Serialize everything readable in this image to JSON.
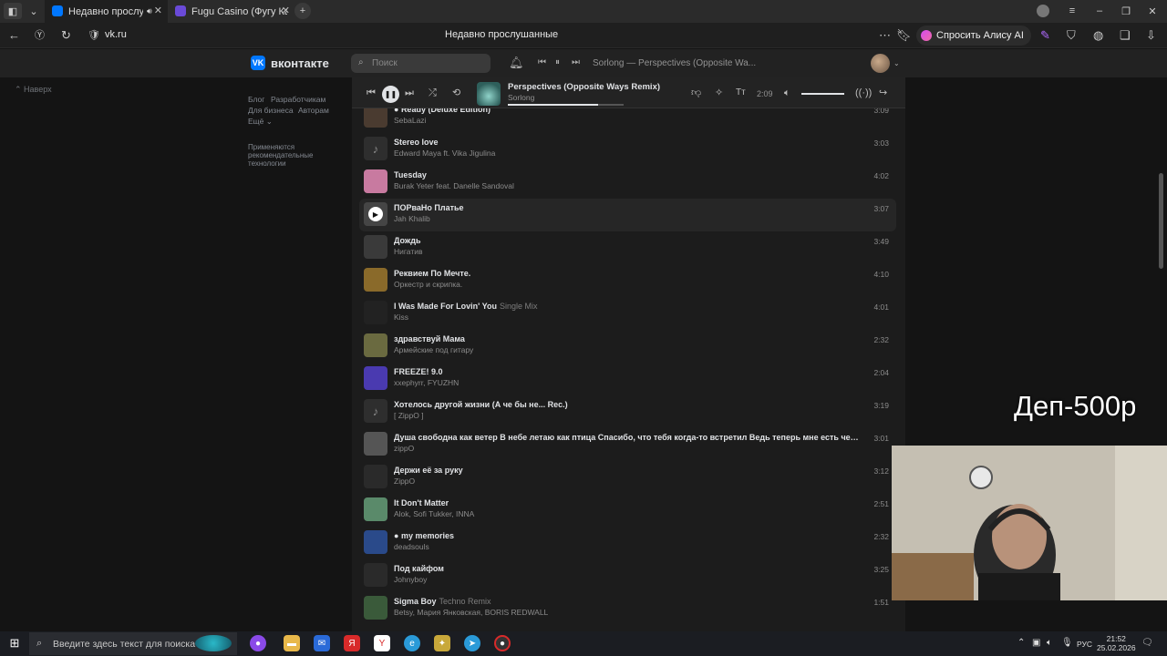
{
  "browser": {
    "tabs": [
      {
        "label": "Недавно прослушанные",
        "active": true
      },
      {
        "label": "Fugu Casino (Фугу Казино)",
        "active": false
      }
    ],
    "url": "vk.ru",
    "page_title": "Недавно прослушанные",
    "alice_label": "Спросить Алису AI"
  },
  "vk": {
    "logo_text": "вконтакте",
    "search_placeholder": "Поиск",
    "header_track": "Sorlong — Perspectives (Opposite Wa..."
  },
  "left": {
    "naverh": "Наверх",
    "links": [
      "Блог",
      "Разработчикам",
      "Для бизнеса",
      "Авторам",
      "Ещё ⌄"
    ],
    "reco": "Применяются рекомендательные технологии"
  },
  "player": {
    "title": "Perspectives (Opposite Ways Remix)",
    "artist": "Sorlong",
    "time": "2:09",
    "progress": 0.78,
    "volume": 1.0
  },
  "tracks": [
    {
      "title": "Ready (Deluxe Edition)",
      "prefix": "● ",
      "artist": "SebaLazi",
      "dur": "3:09",
      "cover": "#4a3b30"
    },
    {
      "title": "Stereo love",
      "artist": "Edward Maya ft. Vika Jigulina",
      "dur": "3:03",
      "cover": "note"
    },
    {
      "title": "Tuesday",
      "artist": "Burak Yeter feat. Danelle Sandoval",
      "dur": "4:02",
      "cover": "#c87aa0"
    },
    {
      "title": "ПОРваНо Платье",
      "artist": "Jah Khalib",
      "dur": "3:07",
      "cover": "#6b6b6b",
      "hover": true
    },
    {
      "title": "Дождь",
      "artist": "Нигатив",
      "dur": "3:49",
      "cover": "#3a3a3a"
    },
    {
      "title": "Реквием По Мечте.",
      "artist": "Оркестр и скрипка.",
      "dur": "4:10",
      "cover": "#8a6a2a"
    },
    {
      "title": "I Was Made For Lovin' You",
      "sub": "Single Mix",
      "artist": "Kiss",
      "dur": "4:01",
      "cover": "#222222"
    },
    {
      "title": "здравствуй Мама",
      "artist": "Армейские под гитару",
      "dur": "2:32",
      "cover": "#6a6a40"
    },
    {
      "title": "FREEZE! 9.0",
      "artist": "xxephyrr, FYUZHN",
      "dur": "2:04",
      "cover": "#4a3ab0"
    },
    {
      "title": "Хотелось другой жизни (А че бы не... Rec.)",
      "artist": "[ ZippO ]",
      "dur": "3:19",
      "cover": "note"
    },
    {
      "title": "Душа свободна как ветер В небе летаю как птица Спасибо, что тебя когда-то встретил Ведь теперь мне есть чем в жизни гордиться",
      "artist": "zippO",
      "dur": "3:01",
      "cover": "#555555"
    },
    {
      "title": "Держи её за руку",
      "artist": "ZippO",
      "dur": "3:12",
      "cover": "#2a2a2a"
    },
    {
      "title": "It Don't Matter",
      "artist": "Alok, Sofi Tukker, INNA",
      "dur": "2:51",
      "cover": "#5a8a6a"
    },
    {
      "title": "my memories",
      "prefix": "● ",
      "artist": "deadsouls",
      "dur": "2:32",
      "cover": "#2a4a8a"
    },
    {
      "title": "Под кайфом",
      "artist": "Johnyboy",
      "dur": "3:25",
      "cover": "#2a2a2a"
    },
    {
      "title": "Sigma Boy",
      "sub": "Techno Remix",
      "artist": "Betsy, Мария Янковская, BORIS REDWALL",
      "dur": "1:51",
      "cover": "#3a5a3a"
    }
  ],
  "overlay_text": "Деп-500р",
  "taskbar": {
    "search_placeholder": "Введите здесь текст для поиска",
    "lang": "РУС",
    "time": "21:52",
    "date": "25.02.2026"
  }
}
